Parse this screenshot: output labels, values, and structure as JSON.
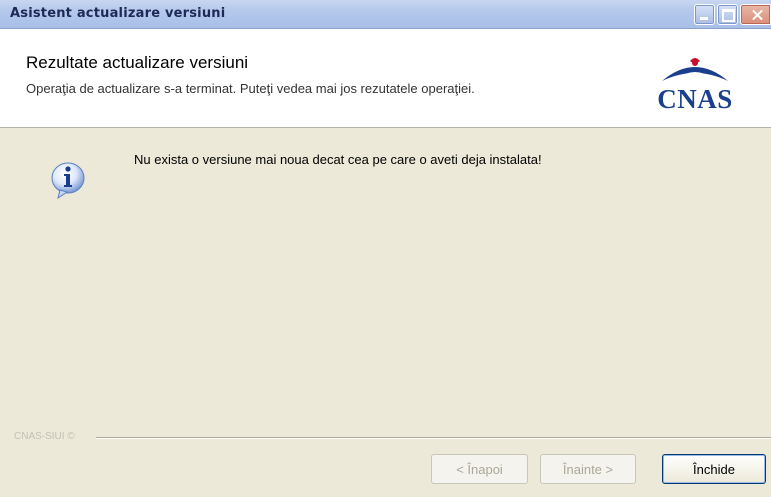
{
  "window": {
    "title": "Asistent actualizare versiuni",
    "controls": {
      "minimize": "minimize-icon",
      "maximize": "maximize-icon",
      "close": "close-icon"
    }
  },
  "header": {
    "title": "Rezultate actualizare versiuni",
    "subtitle": "Operaţia de actualizare s-a terminat. Puteţi vedea mai jos rezutatele operaţiei.",
    "logo_text": "CNAS"
  },
  "body": {
    "icon": "info-icon",
    "message": "Nu exista o versiune mai noua decat cea pe care o aveti deja instalata!"
  },
  "footer": {
    "label": "CNAS-SIUI ©",
    "buttons": {
      "back": "< Înapoi",
      "next": "Înainte >",
      "close": "Închide"
    }
  },
  "colors": {
    "titlebar": "#b4c8ec",
    "dialog_bg": "#ece9d8",
    "logo_blue": "#1b3f8e",
    "logo_red": "#c8102e"
  }
}
